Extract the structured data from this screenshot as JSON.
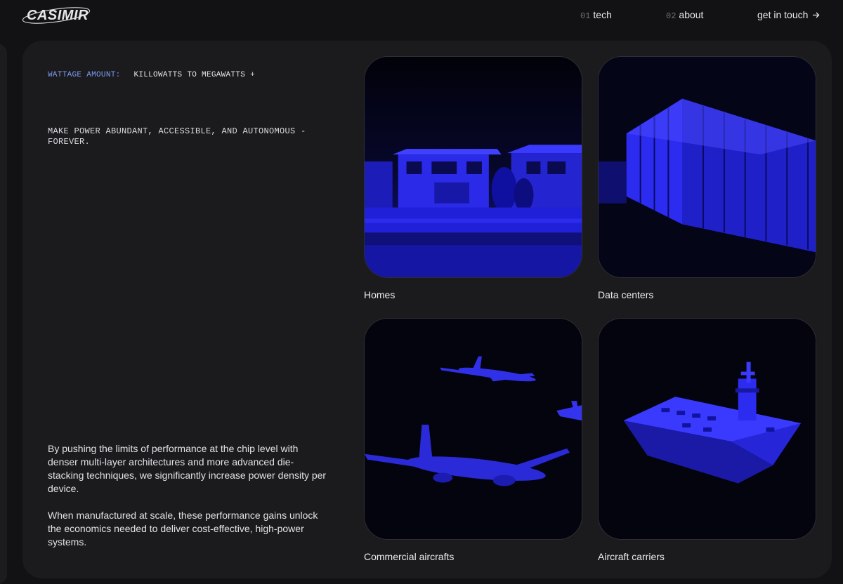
{
  "header": {
    "logo_text": "CASIMIR",
    "nav": [
      {
        "number": "01",
        "label": "tech"
      },
      {
        "number": "02",
        "label": "about"
      }
    ],
    "cta_label": "get in touch",
    "cta_icon": "arrow-right-icon"
  },
  "main": {
    "wattage_label": "WATTAGE AMOUNT:",
    "wattage_value": "KILLOWATTS TO MEGAWATTS +",
    "mission": "MAKE POWER ABUNDANT, ACCESSIBLE, AND AUTONOMOUS - FOREVER.",
    "paragraphs": [
      "By pushing the limits of performance at the chip level with denser multi-layer architectures and more advanced die-stacking techniques, we significantly increase power density per device.",
      "When manufactured at scale, these performance gains unlock the economics needed to deliver cost-effective, high-power systems."
    ],
    "tiles": [
      {
        "caption": "Homes"
      },
      {
        "caption": "Data centers"
      },
      {
        "caption": "Commercial aircrafts"
      },
      {
        "caption": "Aircraft carriers"
      }
    ]
  },
  "colors": {
    "background": "#121214",
    "card": "#1b1b1e",
    "accent_label": "#7c9bf3",
    "image_tint": "#2a2aff"
  }
}
